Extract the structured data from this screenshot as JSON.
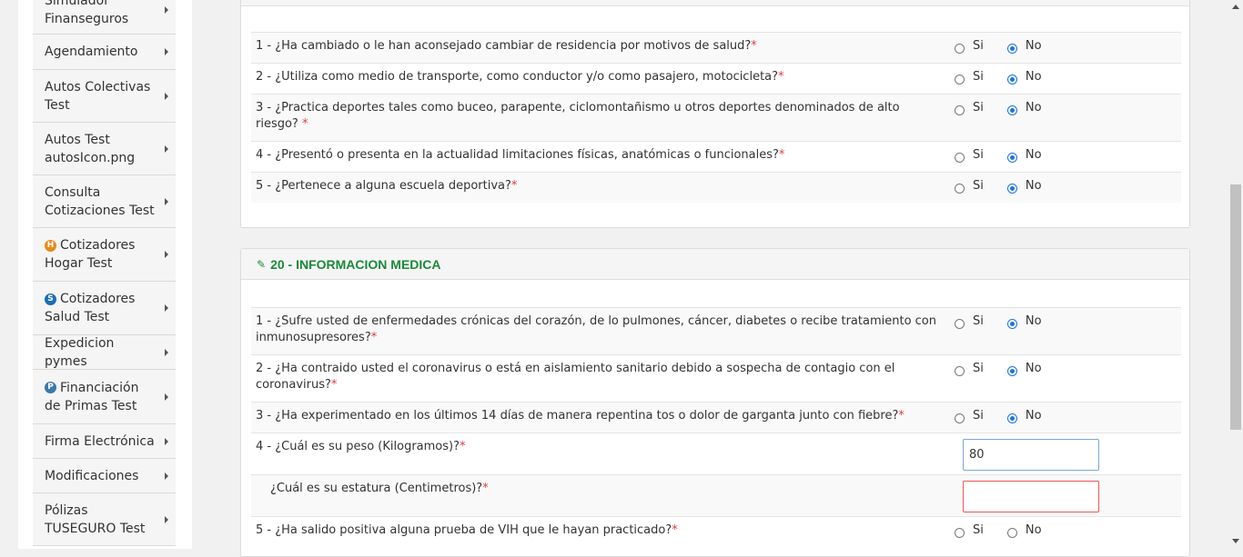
{
  "sidebar": {
    "items": [
      {
        "label": "Simulador Finanseguros",
        "icon": null
      },
      {
        "label": "Agendamiento",
        "icon": null
      },
      {
        "label": "Autos Colectivas Test",
        "icon": null
      },
      {
        "label": "Autos Test autosIcon.png",
        "icon": null
      },
      {
        "label": "Consulta Cotizaciones Test",
        "icon": null
      },
      {
        "label": "Cotizadores Hogar Test",
        "icon": "hogar-icon",
        "icon_glyph": "H",
        "icon_color": "#e8891a"
      },
      {
        "label": "Cotizadores Salud Test",
        "icon": "salud-icon",
        "icon_glyph": "S",
        "icon_color": "#1b6fb5"
      },
      {
        "label": "Expedicion pymes",
        "icon": null
      },
      {
        "label": "Financiación de Primas Test",
        "icon": "financiacion-icon",
        "icon_glyph": "P",
        "icon_color": "#3c78a8"
      },
      {
        "label": "Firma Electrónica",
        "icon": null
      },
      {
        "label": "Modificaciones",
        "icon": null
      },
      {
        "label": "Pólizas TUSEGURO Test",
        "icon": null
      }
    ]
  },
  "radio_labels": {
    "yes": "Si",
    "no": "No"
  },
  "section1": {
    "questions": [
      {
        "text": "1 - ¿Ha cambiado o le han aconsejado cambiar de residencia por motivos de salud?",
        "answer": "No"
      },
      {
        "text": "2 - ¿Utiliza como medio de transporte, como conductor y/o como pasajero, motocicleta?",
        "answer": "No"
      },
      {
        "text": "3 - ¿Practica deportes tales como buceo, parapente, ciclomontañismo u otros deportes denominados de alto riesgo? ",
        "answer": "No"
      },
      {
        "text": "4 - ¿Presentó o presenta en la actualidad limitaciones físicas, anatómicas o funcionales?",
        "answer": "No"
      },
      {
        "text": "5 - ¿Pertenece a alguna escuela deportiva?",
        "answer": "No"
      }
    ]
  },
  "section2": {
    "title": "20 - INFORMACION MEDICA",
    "questions": [
      {
        "text": "1 - ¿Sufre usted de enfermedades crónicas del corazón, de lo pulmones, cáncer, diabetes o recibe tratamiento con inmunosupresores?",
        "answer": "No"
      },
      {
        "text": "2 - ¿Ha contraido usted el coronavirus o está en aislamiento sanitario debido a sospecha de contagio con el coronavirus?",
        "answer": "No"
      },
      {
        "text": "3 - ¿Ha experimentado en los últimos 14 días de manera repentina tos o dolor de garganta junto con fiebre?",
        "answer": "No"
      },
      {
        "text": "4 - ¿Cuál es su peso (Kilogramos)?",
        "value": "80"
      },
      {
        "text": "¿Cuál es su estatura (Centimetros)?",
        "value": ""
      },
      {
        "text": "5 - ¿Ha salido positiva alguna prueba de VIH que le hayan practicado?",
        "answer": ""
      }
    ]
  },
  "required_mark": "*"
}
